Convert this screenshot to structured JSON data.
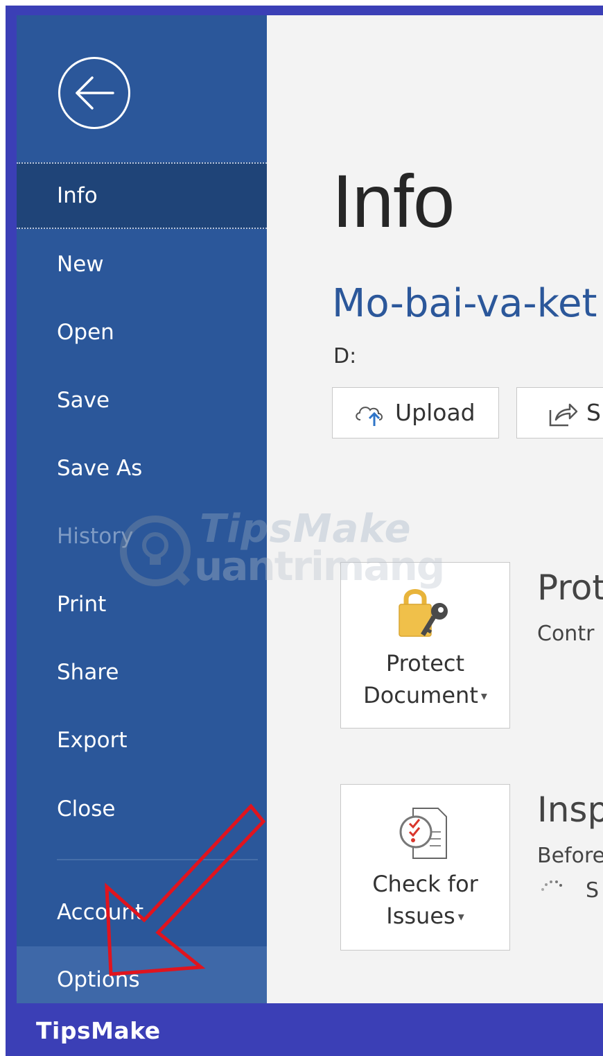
{
  "sidebar": {
    "back_label": "",
    "items": [
      {
        "label": "Info",
        "state": "active"
      },
      {
        "label": "New",
        "state": "normal"
      },
      {
        "label": "Open",
        "state": "normal"
      },
      {
        "label": "Save",
        "state": "normal"
      },
      {
        "label": "Save As",
        "state": "normal"
      },
      {
        "label": "History",
        "state": "disabled"
      },
      {
        "label": "Print",
        "state": "normal"
      },
      {
        "label": "Share",
        "state": "normal"
      },
      {
        "label": "Export",
        "state": "normal"
      },
      {
        "label": "Close",
        "state": "normal"
      },
      {
        "label": "Account",
        "state": "normal"
      },
      {
        "label": "Options",
        "state": "hover"
      }
    ]
  },
  "main": {
    "title": "Info",
    "doc_name": "Mo-bai-va-ket",
    "doc_path": "D:",
    "upload_label": "Upload",
    "share_label": "S",
    "protect": {
      "tile_line1": "Protect",
      "tile_line2": "Document",
      "section_title": "Prot",
      "section_desc": "Contr"
    },
    "inspect": {
      "tile_line1": "Check for",
      "tile_line2": "Issues",
      "section_title": "Insp",
      "section_desc": "Before",
      "section_sub": "S"
    }
  },
  "watermark": {
    "line1": "TipsMake",
    "line2": "uantrimang"
  },
  "brand": {
    "text": "TipsMake"
  },
  "colors": {
    "frame": "#3b3fb6",
    "sidebar": "#2b579a",
    "sidebar_active": "#1f4478",
    "content_bg": "#f3f3f3",
    "doc_name": "#2b579a",
    "annotation_arrow": "#e0141e"
  },
  "icons": {
    "back": "back-arrow-circle-icon",
    "upload": "cloud-upload-icon",
    "share": "share-icon",
    "protect": "lock-key-icon",
    "check": "inspect-document-icon"
  }
}
